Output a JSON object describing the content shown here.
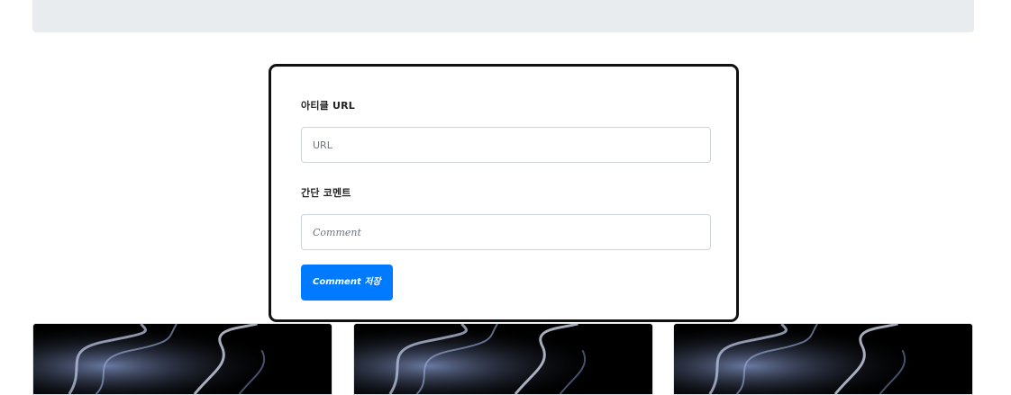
{
  "form": {
    "url_label": "아티클 URL",
    "url_placeholder": "URL",
    "comment_label": "간단 코멘트",
    "comment_placeholder": "Comment",
    "submit_label": "Comment 저장"
  },
  "cards": [
    {
      "image": "smoke-image"
    },
    {
      "image": "smoke-image"
    },
    {
      "image": "smoke-image"
    }
  ],
  "colors": {
    "banner": "#e9ecef",
    "primary_button": "#007bff",
    "card_border": "#111111"
  }
}
